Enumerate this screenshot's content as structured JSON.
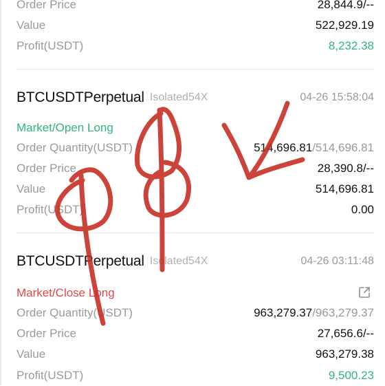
{
  "top_order": {
    "order_price_label": "Order Price",
    "order_price_value": "28,844.9/--",
    "value_label": "Value",
    "value_value": "522,929.19",
    "profit_label": "Profit(USDT)",
    "profit_value": "8,232.38"
  },
  "order_1": {
    "symbol": "BTCUSDTPerpetual",
    "margin": "Isolated54X",
    "time": "04-26 15:58:04",
    "side": "Market/Open Long",
    "qty_label": "Order Quantity(USDT)",
    "qty_filled": "514,696.81",
    "qty_total": "/514,696.81",
    "price_label": "Order Price",
    "price_value": "28,390.8/--",
    "value_label": "Value",
    "value_value": "514,696.81",
    "profit_label": "Profit(USDT)",
    "profit_value": "0.00"
  },
  "order_2": {
    "symbol": "BTCUSDTPerpetual",
    "margin": "Isolated54X",
    "time": "04-26 03:11:48",
    "side": "Market/Close Long",
    "qty_label": "Order Quantity(USDT)",
    "qty_filled": "963,279.37",
    "qty_total": "/963,279.37",
    "price_label": "Order Price",
    "price_value": "27,656.6/--",
    "value_label": "Value",
    "value_value": "963,279.38",
    "profit_label": "Profit(USDT)",
    "profit_value": "9,500.23"
  },
  "icons": {
    "share": "share-icon"
  },
  "colors": {
    "profit_green": "#2fb67a",
    "close_red": "#e04848",
    "annotation": "#c62a1e"
  }
}
